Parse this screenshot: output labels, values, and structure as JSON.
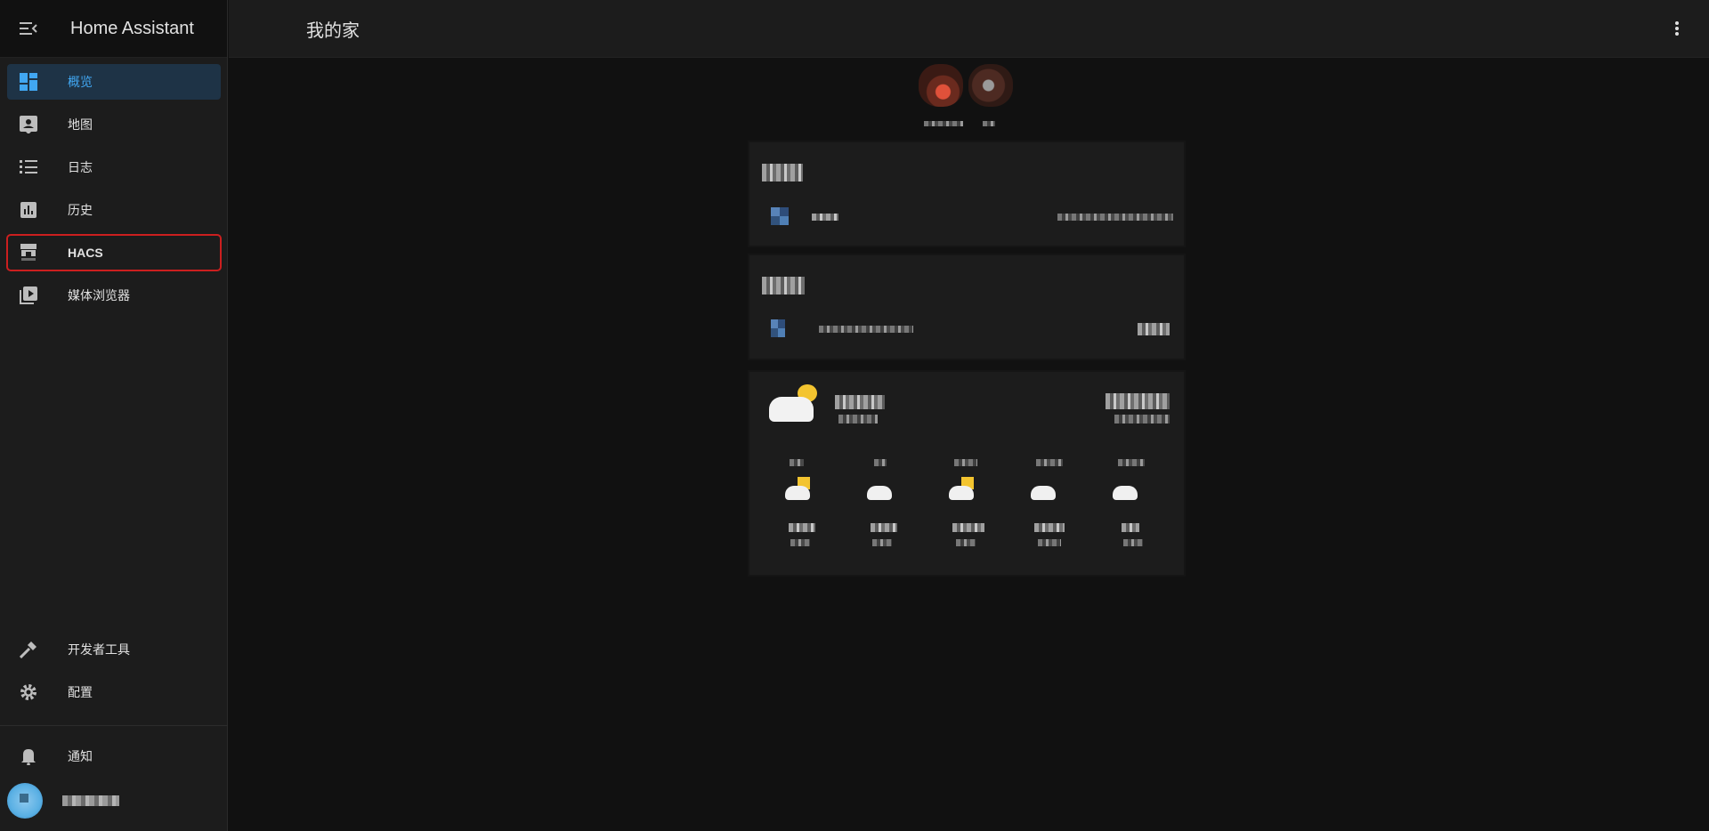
{
  "app": {
    "title": "Home Assistant"
  },
  "header": {
    "page_title": "我的家"
  },
  "sidebar": {
    "items": [
      {
        "label": "概览",
        "icon": "dashboard-icon",
        "active": true
      },
      {
        "label": "地图",
        "icon": "account-box-icon"
      },
      {
        "label": "日志",
        "icon": "format-list-bulleted-icon"
      },
      {
        "label": "历史",
        "icon": "chart-box-icon"
      },
      {
        "label": "HACS",
        "icon": "hacs-icon",
        "highlighted": true
      },
      {
        "label": "媒体浏览器",
        "icon": "play-box-multiple-icon"
      }
    ],
    "bottom_items": [
      {
        "label": "开发者工具",
        "icon": "hammer-icon"
      },
      {
        "label": "配置",
        "icon": "cog-icon"
      }
    ],
    "notifications": {
      "label": "通知",
      "icon": "bell-icon"
    },
    "user": {
      "name": "████"
    }
  },
  "colors": {
    "background": "#111111",
    "surface": "#1c1c1c",
    "accent": "#41a7f2",
    "active_bg": "#1e3346",
    "highlight_border": "#cc1f1f"
  }
}
